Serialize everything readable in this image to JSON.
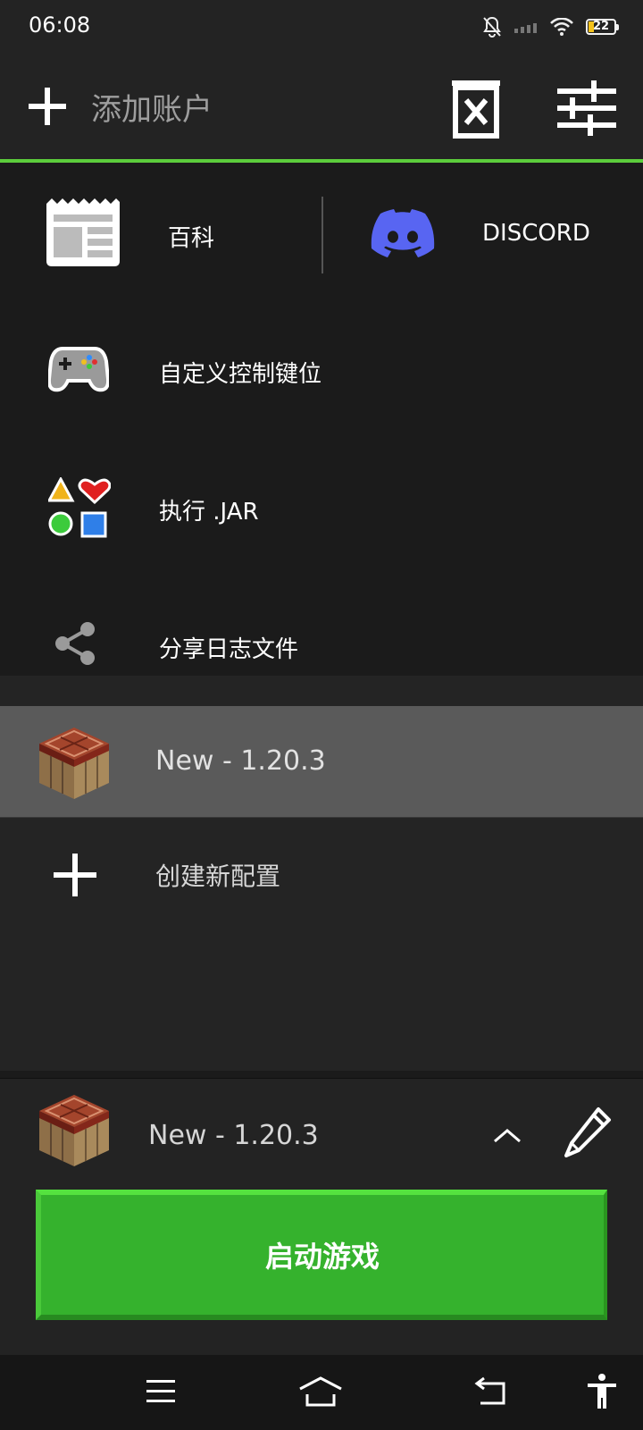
{
  "status_bar": {
    "time": "06:08",
    "battery_level": "22",
    "icons": [
      "bell-off-icon",
      "signal-icon",
      "wifi-icon",
      "battery-icon"
    ]
  },
  "header": {
    "add_account_label": "添加账户",
    "icons": [
      "plus-icon",
      "delete-account-icon",
      "settings-sliders-icon"
    ]
  },
  "menu": {
    "wiki_label": "百科",
    "discord_label": "DISCORD",
    "custom_controls_label": "自定义控制键位",
    "execute_jar_label": "执行 .JAR",
    "share_logs_label": "分享日志文件"
  },
  "profiles": {
    "items": [
      {
        "name": "New - 1.20.3",
        "selected": true
      }
    ],
    "create_label": "创建新配置"
  },
  "bottom_bar": {
    "selected_profile": "New - 1.20.3",
    "launch_label": "启动游戏"
  },
  "colors": {
    "accent_green": "#5ccd3c",
    "launch_green": "#35b22d",
    "discord_blurple": "#5865f2"
  },
  "nav_bar": {
    "icons": [
      "menu-icon",
      "home-icon",
      "back-icon",
      "accessibility-icon"
    ]
  }
}
